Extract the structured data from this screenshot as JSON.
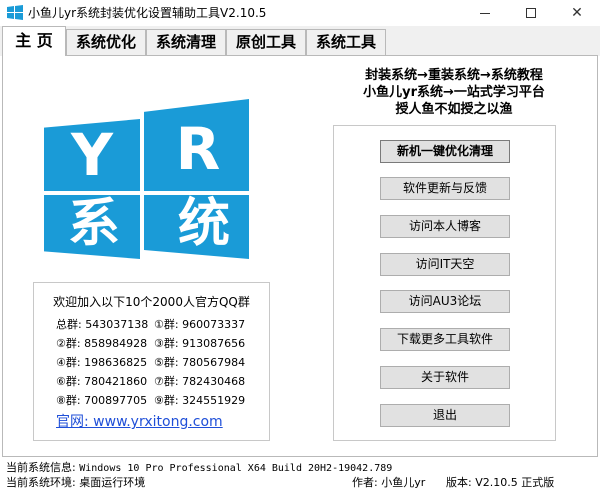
{
  "window": {
    "title": "小鱼儿yr系统封装优化设置辅助工具V2.10.5",
    "close_glyph": "✕"
  },
  "tabs": [
    {
      "label": "主 页",
      "active": true
    },
    {
      "label": "系统优化",
      "active": false
    },
    {
      "label": "系统清理",
      "active": false
    },
    {
      "label": "原创工具",
      "active": false
    },
    {
      "label": "系统工具",
      "active": false
    }
  ],
  "logo": {
    "chars": [
      "Y",
      "R",
      "系",
      "统"
    ],
    "color": "#1a9bd7"
  },
  "slogans": [
    "封装系统→重装系统→系统教程",
    "小鱼儿yr系统→一站式学习平台",
    "授人鱼不如授之以渔"
  ],
  "qq": {
    "title": "欢迎加入以下10个2000人官方QQ群",
    "groups": [
      {
        "label": "总群:",
        "number": "543037138"
      },
      {
        "label": "①群:",
        "number": "960073337"
      },
      {
        "label": "②群:",
        "number": "858984928"
      },
      {
        "label": "③群:",
        "number": "913087656"
      },
      {
        "label": "④群:",
        "number": "198636825"
      },
      {
        "label": "⑤群:",
        "number": "780567984"
      },
      {
        "label": "⑥群:",
        "number": "780421860"
      },
      {
        "label": "⑦群:",
        "number": "782430468"
      },
      {
        "label": "⑧群:",
        "number": "700897705"
      },
      {
        "label": "⑨群:",
        "number": "324551929"
      }
    ],
    "website": "官网: www.yrxitong.com"
  },
  "buttons": [
    "新机一键优化清理",
    "软件更新与反馈",
    "访问本人博客",
    "访问IT天空",
    "访问AU3论坛",
    "下载更多工具软件",
    "关于软件",
    "退出"
  ],
  "status": {
    "system_info_label": "当前系统信息:",
    "system_info_value": "Windows 10 Pro Professional X64 Build 20H2-19042.789",
    "env_label": "当前系统环境:",
    "env_value": "桌面运行环境",
    "author_label": "作者:",
    "author_value": "小鱼儿yr",
    "version_label": "版本:",
    "version_value": "V2.10.5 正式版"
  }
}
